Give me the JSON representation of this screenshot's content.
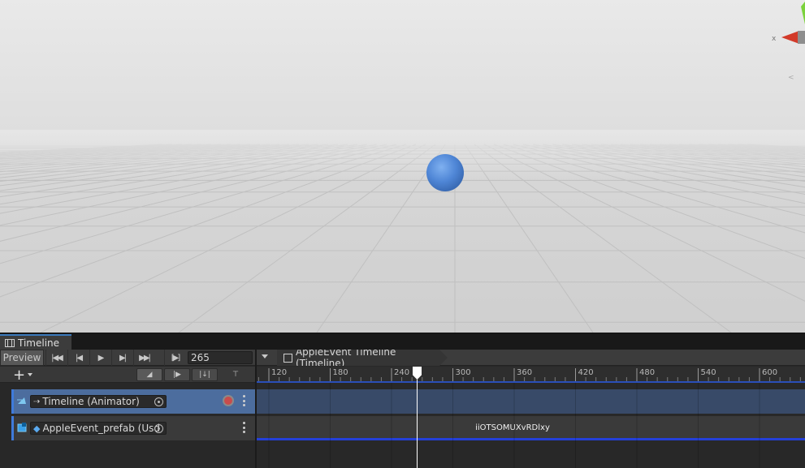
{
  "window": {
    "tab_label": "Timeline"
  },
  "toolbar": {
    "preview_label": "Preview",
    "frame_value": "265",
    "asset_name": "AppleEvent Timeline (Timeline)",
    "go_first_icon": "skip-back-icon",
    "prev_frame_icon": "step-back-icon",
    "play_icon": "play-icon",
    "next_frame_icon": "step-forward-icon",
    "go_last_icon": "skip-forward-icon",
    "range_icon": "play-range-icon"
  },
  "ruler": {
    "ticks": [
      "120",
      "180",
      "240",
      "300",
      "360",
      "420",
      "480",
      "540",
      "600"
    ]
  },
  "tracks": [
    {
      "label": "Timeline (Animator)",
      "type": "animation",
      "selected": true,
      "record": true
    },
    {
      "label": "AppleEvent_prefab (Usd",
      "type": "prefab",
      "selected": false,
      "clip_label": "iiOTSOMUXvRDlxy"
    }
  ],
  "scene": {
    "gizmo_axis_label": "x"
  },
  "colors": {
    "accent": "#3f7bdb",
    "selected_track": "#4c6d9e",
    "record": "#c84c4c",
    "clip_bar": "#2440d8",
    "sphere": "#5b8fd8"
  }
}
